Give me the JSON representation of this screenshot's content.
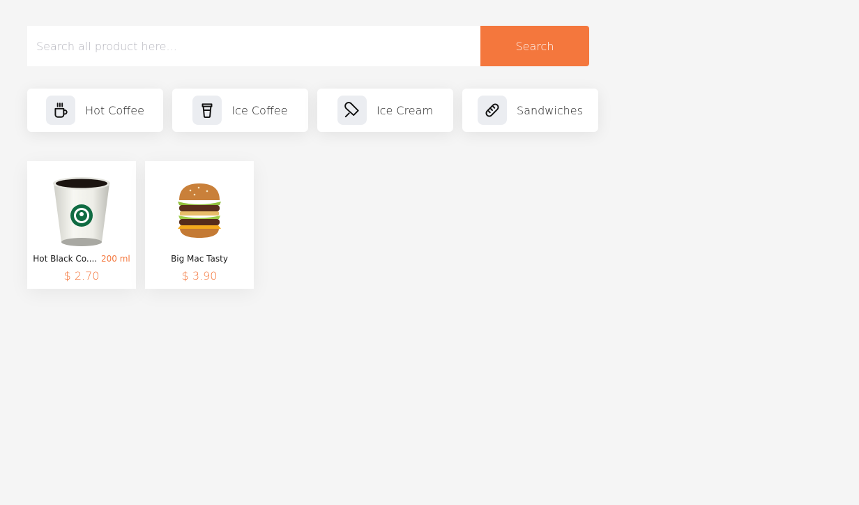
{
  "search": {
    "placeholder": "Search all product here...",
    "button_label": "Search"
  },
  "categories": [
    {
      "label": "Hot Coffee",
      "icon": "hot-coffee-mug-icon"
    },
    {
      "label": "Ice Coffee",
      "icon": "ice-coffee-cup-icon"
    },
    {
      "label": "Ice Cream",
      "icon": "ice-cream-popsicle-icon"
    },
    {
      "label": "Sandwiches",
      "icon": "bread-icon"
    }
  ],
  "products": [
    {
      "name": "Hot Black Co....",
      "volume": "200 ml",
      "price": "$ 2.70",
      "image": "coffee-cup-image"
    },
    {
      "name": "Big Mac Tasty",
      "volume": "",
      "price": "$ 3.90",
      "image": "burger-image"
    }
  ],
  "colors": {
    "accent": "#f4773d",
    "background": "#f5f5f5",
    "card": "#ffffff",
    "icon_bg": "#ebedf1"
  }
}
